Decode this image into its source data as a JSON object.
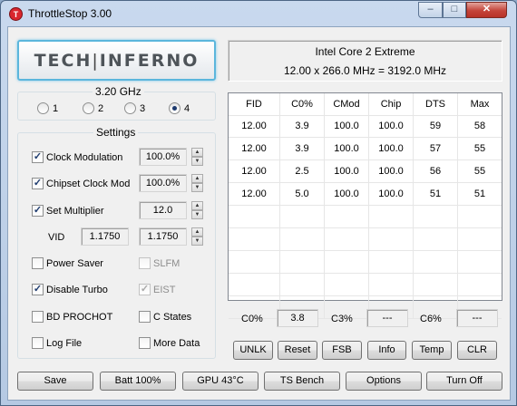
{
  "window": {
    "title": "ThrottleStop 3.00",
    "app_icon": "T"
  },
  "logo": {
    "left": "TECH",
    "separator": "|",
    "right": "INFERNO"
  },
  "cpu": {
    "name": "Intel Core 2 Extreme",
    "freq_line": "12.00 x 266.0 MHz = 3192.0 MHz"
  },
  "profile": {
    "speed": "3.20 GHz",
    "options": [
      "1",
      "2",
      "3",
      "4"
    ],
    "selected": "4"
  },
  "settings": {
    "title": "Settings",
    "clock_modulation": {
      "label": "Clock Modulation",
      "checked": true,
      "value": "100.0%"
    },
    "chipset_clock_mod": {
      "label": "Chipset Clock Mod",
      "checked": true,
      "value": "100.0%"
    },
    "set_multiplier": {
      "label": "Set Multiplier",
      "checked": true,
      "value": "12.0"
    },
    "vid": {
      "label": "VID",
      "value1": "1.1750",
      "value2": "1.1750"
    },
    "power_saver": {
      "label": "Power Saver",
      "checked": false
    },
    "slfm": {
      "label": "SLFM",
      "checked": false,
      "disabled": true
    },
    "disable_turbo": {
      "label": "Disable Turbo",
      "checked": true
    },
    "eist": {
      "label": "EIST",
      "checked": true,
      "disabled": true
    },
    "bd_prochot": {
      "label": "BD PROCHOT",
      "checked": false
    },
    "c_states": {
      "label": "C States",
      "checked": false
    },
    "log_file": {
      "label": "Log File",
      "checked": false
    },
    "more_data": {
      "label": "More Data",
      "checked": false
    }
  },
  "table": {
    "columns": [
      "FID",
      "C0%",
      "CMod",
      "Chip",
      "DTS",
      "Max"
    ],
    "rows": [
      [
        "12.00",
        "3.9",
        "100.0",
        "100.0",
        "59",
        "58"
      ],
      [
        "12.00",
        "3.9",
        "100.0",
        "100.0",
        "57",
        "55"
      ],
      [
        "12.00",
        "2.5",
        "100.0",
        "100.0",
        "56",
        "55"
      ],
      [
        "12.00",
        "5.0",
        "100.0",
        "100.0",
        "51",
        "51"
      ]
    ]
  },
  "stats": {
    "c0_label": "C0%",
    "c0_value": "3.8",
    "c3_label": "C3%",
    "c3_value": "---",
    "c6_label": "C6%",
    "c6_value": "---"
  },
  "tool_buttons": [
    "UNLK",
    "Reset",
    "FSB",
    "Info",
    "Temp",
    "CLR"
  ],
  "bottom_buttons": [
    "Save",
    "Batt 100%",
    "GPU 43°C",
    "TS Bench",
    "Options",
    "Turn Off"
  ]
}
